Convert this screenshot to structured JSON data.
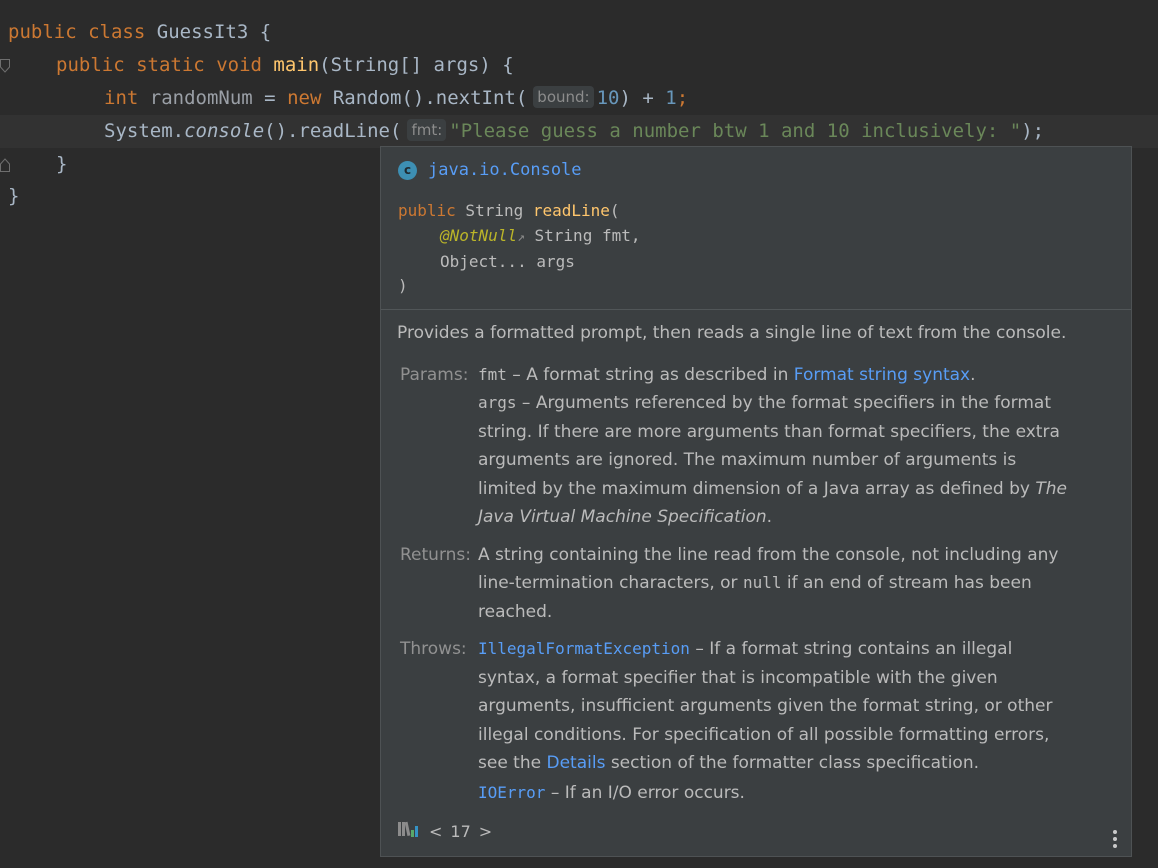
{
  "code": {
    "line1": {
      "kw1": "public",
      "kw2": "class",
      "name": "GuessIt3",
      "brace": "{"
    },
    "line2": {
      "kw1": "public",
      "kw2": "static",
      "kw3": "void",
      "fn": "main",
      "rest": "(String[] args) {"
    },
    "line3": {
      "kw1": "int",
      "var": "randomNum",
      "eq": " = ",
      "kw2": "new",
      "call": " Random().nextInt(",
      "hint": "bound:",
      "num1": "10",
      "mid": ") + ",
      "num2": "1",
      "end": ";"
    },
    "line4": {
      "obj": "System.",
      "method": "console",
      "call": "().readLine(",
      "hint": "fmt:",
      "str": "\"Please guess a number btw 1 and 10 inclusively: \"",
      "end": ");"
    },
    "line5": {
      "brace": "}"
    },
    "line6": {
      "brace": "}"
    }
  },
  "popup": {
    "class_icon": "c",
    "class_name": "java.io.Console",
    "sig": {
      "kw": "public",
      "ret": " String ",
      "fn": "readLine",
      "open": "(",
      "ann": "@NotNull",
      "ann_arrow": "↗",
      "p1": " String fmt,",
      "p2": "Object... args",
      "close": ")"
    },
    "description": "Provides a formatted prompt, then reads a single line of text from the console.",
    "params": {
      "label": "Params:",
      "l1_code": "fmt",
      "l1_a": " – A format string as described in ",
      "l1_link": "Format string syntax",
      "l1_b": ".",
      "l2_code": "args",
      "l2_a": " – Arguments referenced by the format specifiers in the format",
      "l3": "string. If there are more arguments than format specifiers, the extra",
      "l4": "arguments are ignored. The maximum number of arguments is",
      "l5_a": "limited by the maximum dimension of a Java array as defined by ",
      "l5_i": "The",
      "l6_i": "Java Virtual Machine Specification",
      "l6_b": "."
    },
    "returns": {
      "label": "Returns:",
      "l1": "A string containing the line read from the console, not including any",
      "l2_a": "line-termination characters, or ",
      "l2_code": "null",
      "l2_b": " if an end of stream has been",
      "l3": "reached."
    },
    "throws": {
      "label": "Throws:",
      "l1_link": "IllegalFormatException",
      "l1_a": " – If a format string contains an illegal",
      "l2": "syntax, a format specifier that is incompatible with the given",
      "l3": "arguments, insufficient arguments given the format string, or other",
      "l4": "illegal conditions. For specification of all possible formatting errors,",
      "l5_a": "see the ",
      "l5_link": "Details",
      "l5_b": " section of the formatter class specification.",
      "l6_link": "IOError",
      "l6_a": " – If an I/O error occurs."
    },
    "footer": {
      "prev": "<",
      "version": "17",
      "next": ">"
    }
  },
  "colors": {
    "keyword": "#cc7832",
    "function": "#ffc66d",
    "number": "#6897bb",
    "string": "#6a8759",
    "link": "#589df6",
    "annotation": "#bbb529"
  }
}
